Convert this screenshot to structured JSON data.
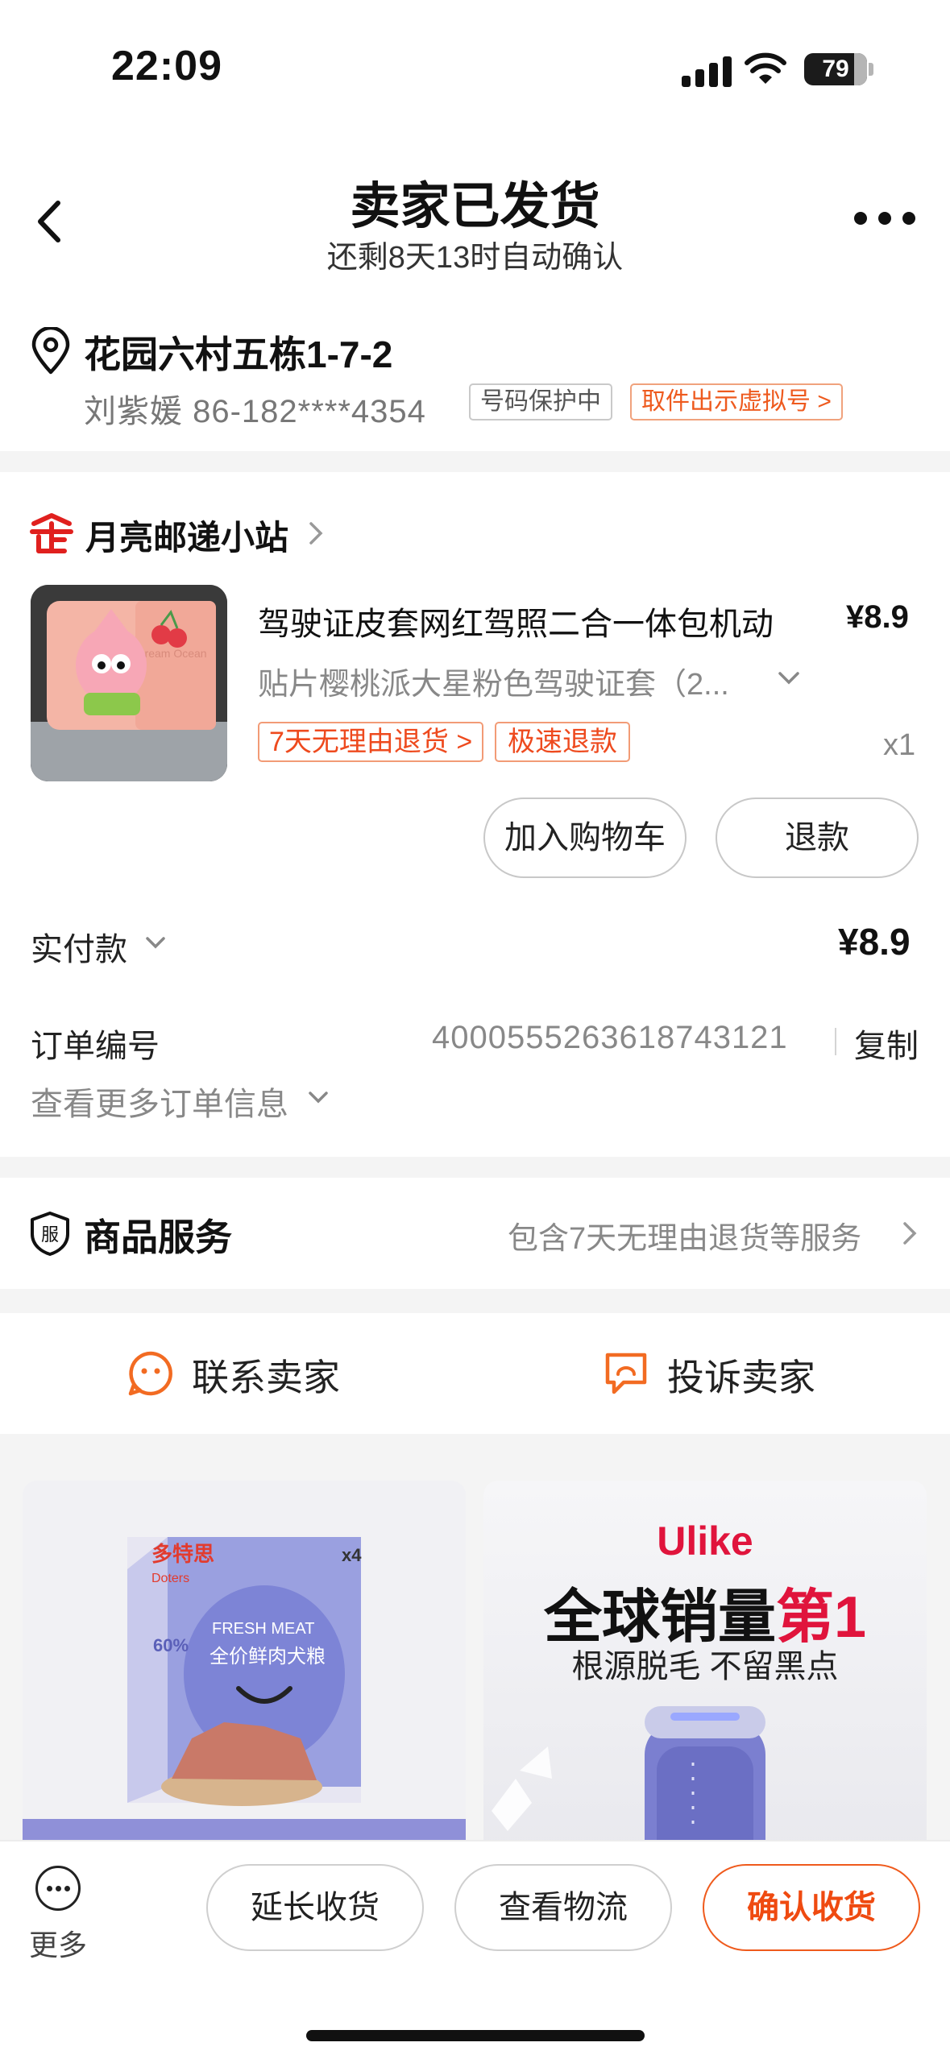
{
  "status_bar": {
    "time": "22:09",
    "battery": "79"
  },
  "header": {
    "title": "卖家已发货",
    "subtitle": "还剩8天13时自动确认"
  },
  "address": {
    "line": "花园六村五栋1-7-2",
    "contact": "刘紫媛 86-182****4354",
    "phone_protect_tag": "号码保护中",
    "virtual_number_tag": "取件出示虚拟号 >"
  },
  "shop": {
    "name": "月亮邮递小站"
  },
  "product": {
    "title": "驾驶证皮套网红驾照二合一体包机动",
    "sku": "贴片樱桃派大星粉色驾驶证套（2...",
    "price": "¥8.9",
    "quantity": "x1",
    "tag_return": "7天无理由退货 >",
    "tag_refund": "极速退款",
    "image_text": "Dream Ocean"
  },
  "actions": {
    "add_cart": "加入购物车",
    "refund": "退款"
  },
  "payment": {
    "label": "实付款",
    "amount": "¥8.9"
  },
  "order": {
    "number_label": "订单编号",
    "number": "4000555263618743121",
    "copy": "复制",
    "more_info": "查看更多订单信息"
  },
  "service": {
    "title": "商品服务",
    "description": "包含7天无理由退货等服务"
  },
  "contact_row": {
    "contact_seller": "联系卖家",
    "complain_seller": "投诉卖家"
  },
  "recommendations": {
    "left": {
      "brand": "多特思",
      "brand_en": "Doters",
      "tag": "FRESH MEAT",
      "product": "全价鲜肉犬粮",
      "count": "x4",
      "badge": "60%"
    },
    "right": {
      "brand": "Ulike",
      "headline_black": "全球销量",
      "headline_red": "第1",
      "subline": "根源脱毛 不留黑点"
    }
  },
  "bottom_bar": {
    "more": "更多",
    "extend": "延长收货",
    "logistics": "查看物流",
    "confirm": "确认收货"
  },
  "colors": {
    "accent": "#ee5a1e",
    "brand_red": "#e0143c",
    "background": "#f4f4f4"
  }
}
